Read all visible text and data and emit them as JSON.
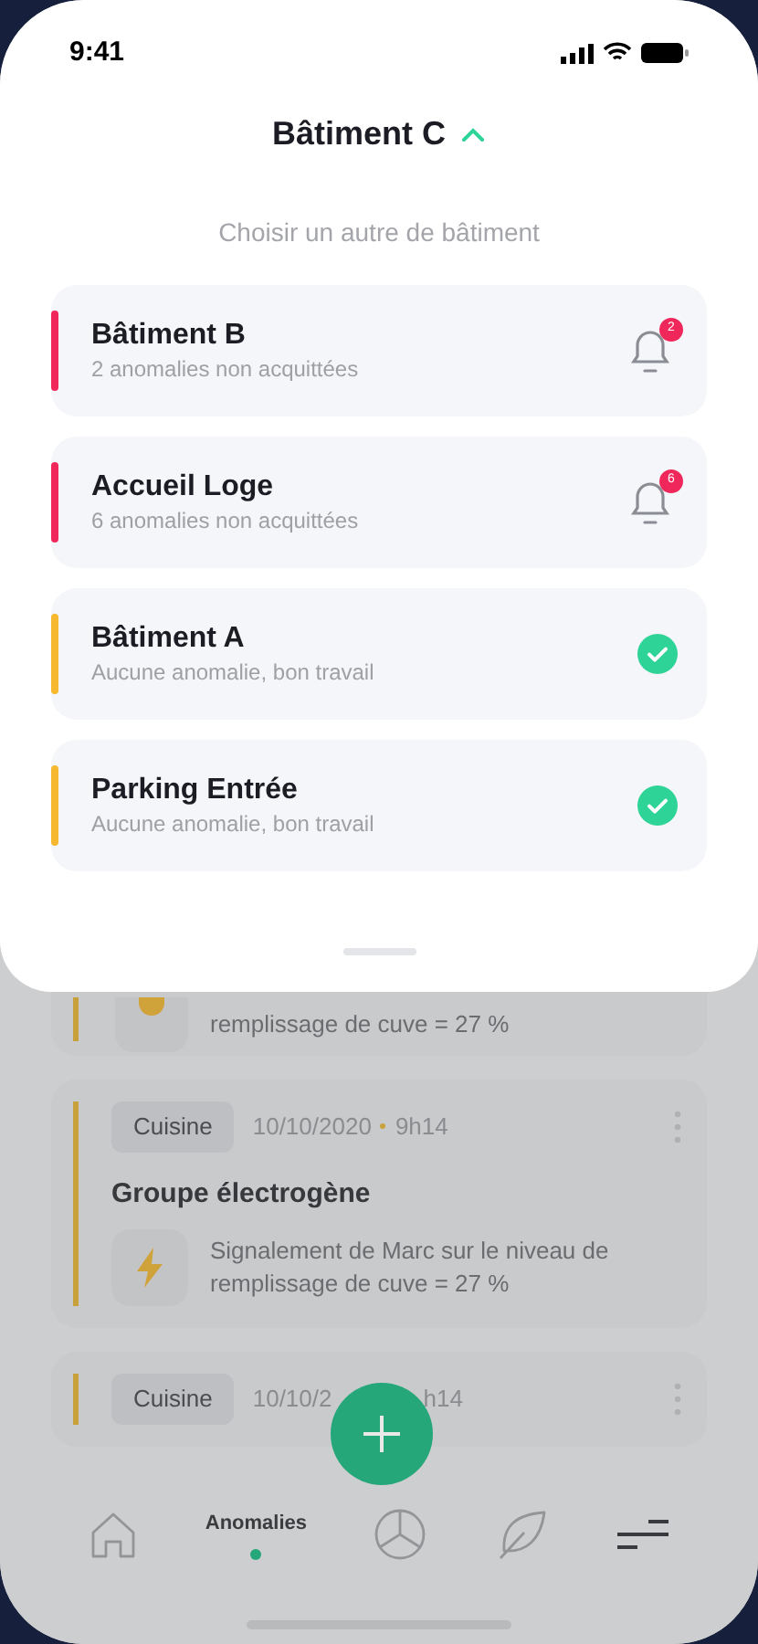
{
  "status_bar": {
    "time": "9:41"
  },
  "sheet": {
    "title": "Bâtiment C",
    "expanded": true,
    "subtitle": "Choisir un autre de bâtiment",
    "buildings": [
      {
        "name": "Bâtiment B",
        "status": "2 anomalies non acquittées",
        "kind": "alert",
        "badge": "2",
        "color": "#f0275a"
      },
      {
        "name": "Accueil Loge",
        "status": "6 anomalies non acquittées",
        "kind": "alert",
        "badge": "6",
        "color": "#f0275a"
      },
      {
        "name": "Bâtiment A",
        "status": "Aucune anomalie, bon travail",
        "kind": "ok",
        "color": "#f5b82e"
      },
      {
        "name": "Parking Entrée",
        "status": "Aucune anomalie, bon travail",
        "kind": "ok",
        "color": "#f5b82e"
      }
    ]
  },
  "anomalies": [
    {
      "kind": "cut",
      "description": "remplissage de cuve = 27 %"
    },
    {
      "kind": "card",
      "tag": "Cuisine",
      "date": "10/10/2020",
      "time": "9h14",
      "title": "Groupe électrogène",
      "description": "Signalement de Marc sur le niveau de remplissage de cuve = 27 %"
    },
    {
      "kind": "covered",
      "tag": "Cuisine",
      "date": "10/10/2",
      "time": "h14"
    }
  ],
  "nav": [
    {
      "kind": "home",
      "selected": false
    },
    {
      "kind": "label",
      "label": "Anomalies",
      "selected": true
    },
    {
      "kind": "chart",
      "selected": false
    },
    {
      "kind": "leaf",
      "selected": false
    },
    {
      "kind": "menu",
      "selected": false
    }
  ]
}
